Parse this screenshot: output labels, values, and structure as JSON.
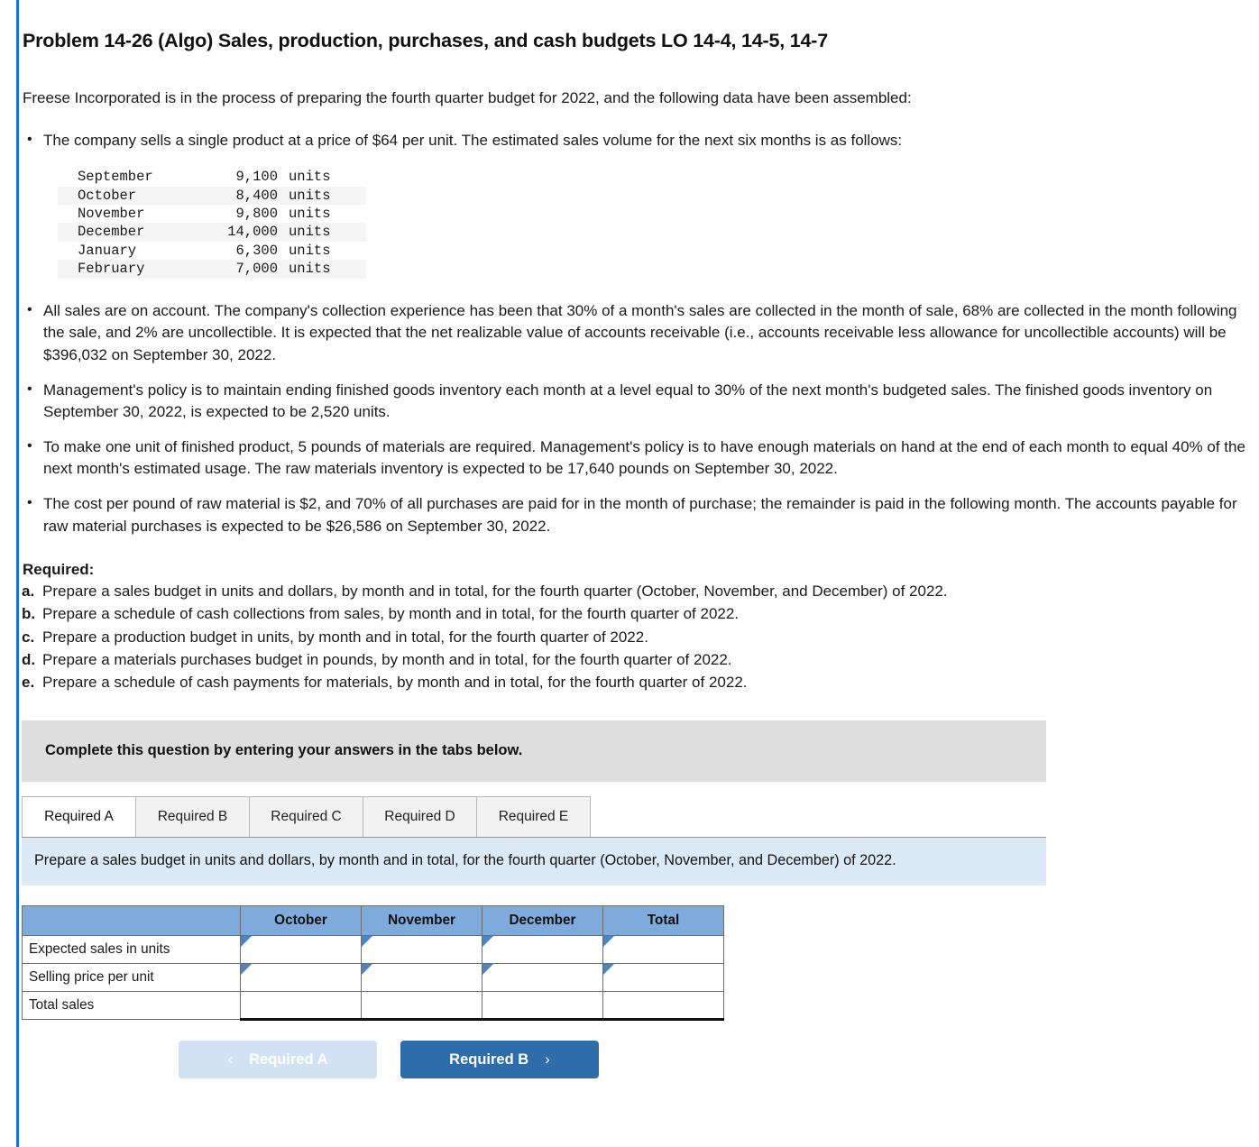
{
  "problem": {
    "title": "Problem 14-26 (Algo) Sales, production, purchases, and cash budgets LO 14-4, 14-5, 14-7",
    "intro": "Freese Incorporated is in the process of preparing the fourth quarter budget for 2022, and the following data have been assembled:"
  },
  "facts": [
    "The company sells a single product at a price of $64 per unit. The estimated sales volume for the next six months is as follows:",
    "All sales are on account. The company's collection experience has been that 30% of a month's sales are collected in the month of sale, 68% are collected in the month following the sale, and 2% are uncollectible. It is expected that the net realizable value of accounts receivable (i.e., accounts receivable less allowance for uncollectible accounts) will be $396,032 on September 30, 2022.",
    "Management's policy is to maintain ending finished goods inventory each month at a level equal to 30% of the next month's budgeted sales. The finished goods inventory on September 30, 2022, is expected to be 2,520 units.",
    "To make one unit of finished product, 5 pounds of materials are required. Management's policy is to have enough materials on hand at the end of each month to equal 40% of the next month's estimated usage. The raw materials inventory is expected to be 17,640 pounds on September 30, 2022.",
    "The cost per pound of raw material is $2, and 70% of all purchases are paid for in the month of purchase; the remainder is paid in the following month. The accounts payable for raw material purchases is expected to be $26,586 on September 30, 2022."
  ],
  "sales_volume": {
    "unit_label": "units",
    "rows": [
      {
        "month": "September",
        "value": "9,100",
        "unit": "units"
      },
      {
        "month": "October",
        "value": "8,400",
        "unit": "units"
      },
      {
        "month": "November",
        "value": "9,800",
        "unit": "units"
      },
      {
        "month": "December",
        "value": "14,000",
        "unit": "units"
      },
      {
        "month": "January",
        "value": "6,300",
        "unit": "units"
      },
      {
        "month": "February",
        "value": "7,000",
        "unit": "units"
      }
    ]
  },
  "required": {
    "heading": "Required:",
    "items": [
      {
        "letter": "a.",
        "text": "Prepare a sales budget in units and dollars, by month and in total, for the fourth quarter (October, November, and December) of 2022."
      },
      {
        "letter": "b.",
        "text": "Prepare a schedule of cash collections from sales, by month and in total, for the fourth quarter of 2022."
      },
      {
        "letter": "c.",
        "text": "Prepare a production budget in units, by month and in total, for the fourth quarter of 2022."
      },
      {
        "letter": "d.",
        "text": "Prepare a materials purchases budget in pounds, by month and in total, for the fourth quarter of 2022."
      },
      {
        "letter": "e.",
        "text": "Prepare a schedule of cash payments for materials, by month and in total, for the fourth quarter of 2022."
      }
    ]
  },
  "instruction_band": {
    "text": "Complete this question by entering your answers in the tabs below."
  },
  "tabs": [
    {
      "label": "Required A",
      "active": true
    },
    {
      "label": "Required B",
      "active": false
    },
    {
      "label": "Required C",
      "active": false
    },
    {
      "label": "Required D",
      "active": false
    },
    {
      "label": "Required E",
      "active": false
    }
  ],
  "tab_panel": {
    "instruction": "Prepare a sales budget in units and dollars, by month and in total, for the fourth quarter (October, November, and December) of 2022."
  },
  "answer_table": {
    "corner_header": "",
    "columns": [
      "October",
      "November",
      "December",
      "Total"
    ],
    "rows": [
      {
        "label": "Expected sales in units",
        "editable": true,
        "values": [
          "",
          "",
          "",
          ""
        ]
      },
      {
        "label": "Selling price per unit",
        "editable": true,
        "values": [
          "",
          "",
          "",
          ""
        ]
      },
      {
        "label": "Total sales",
        "editable": false,
        "values": [
          "",
          "",
          "",
          ""
        ]
      }
    ]
  },
  "navigation": {
    "prev_label": "Required A",
    "next_label": "Required B",
    "prev_chevron": "‹",
    "next_chevron": "›"
  },
  "colors": {
    "left_rule": "#1c6fd4",
    "grey_band": "#dedede",
    "blue_panel": "#dceaf7",
    "table_header": "#7fabdc",
    "input_border": "#4b86c4",
    "next_button": "#2e6daa",
    "prev_button": "#d3e2f2"
  }
}
